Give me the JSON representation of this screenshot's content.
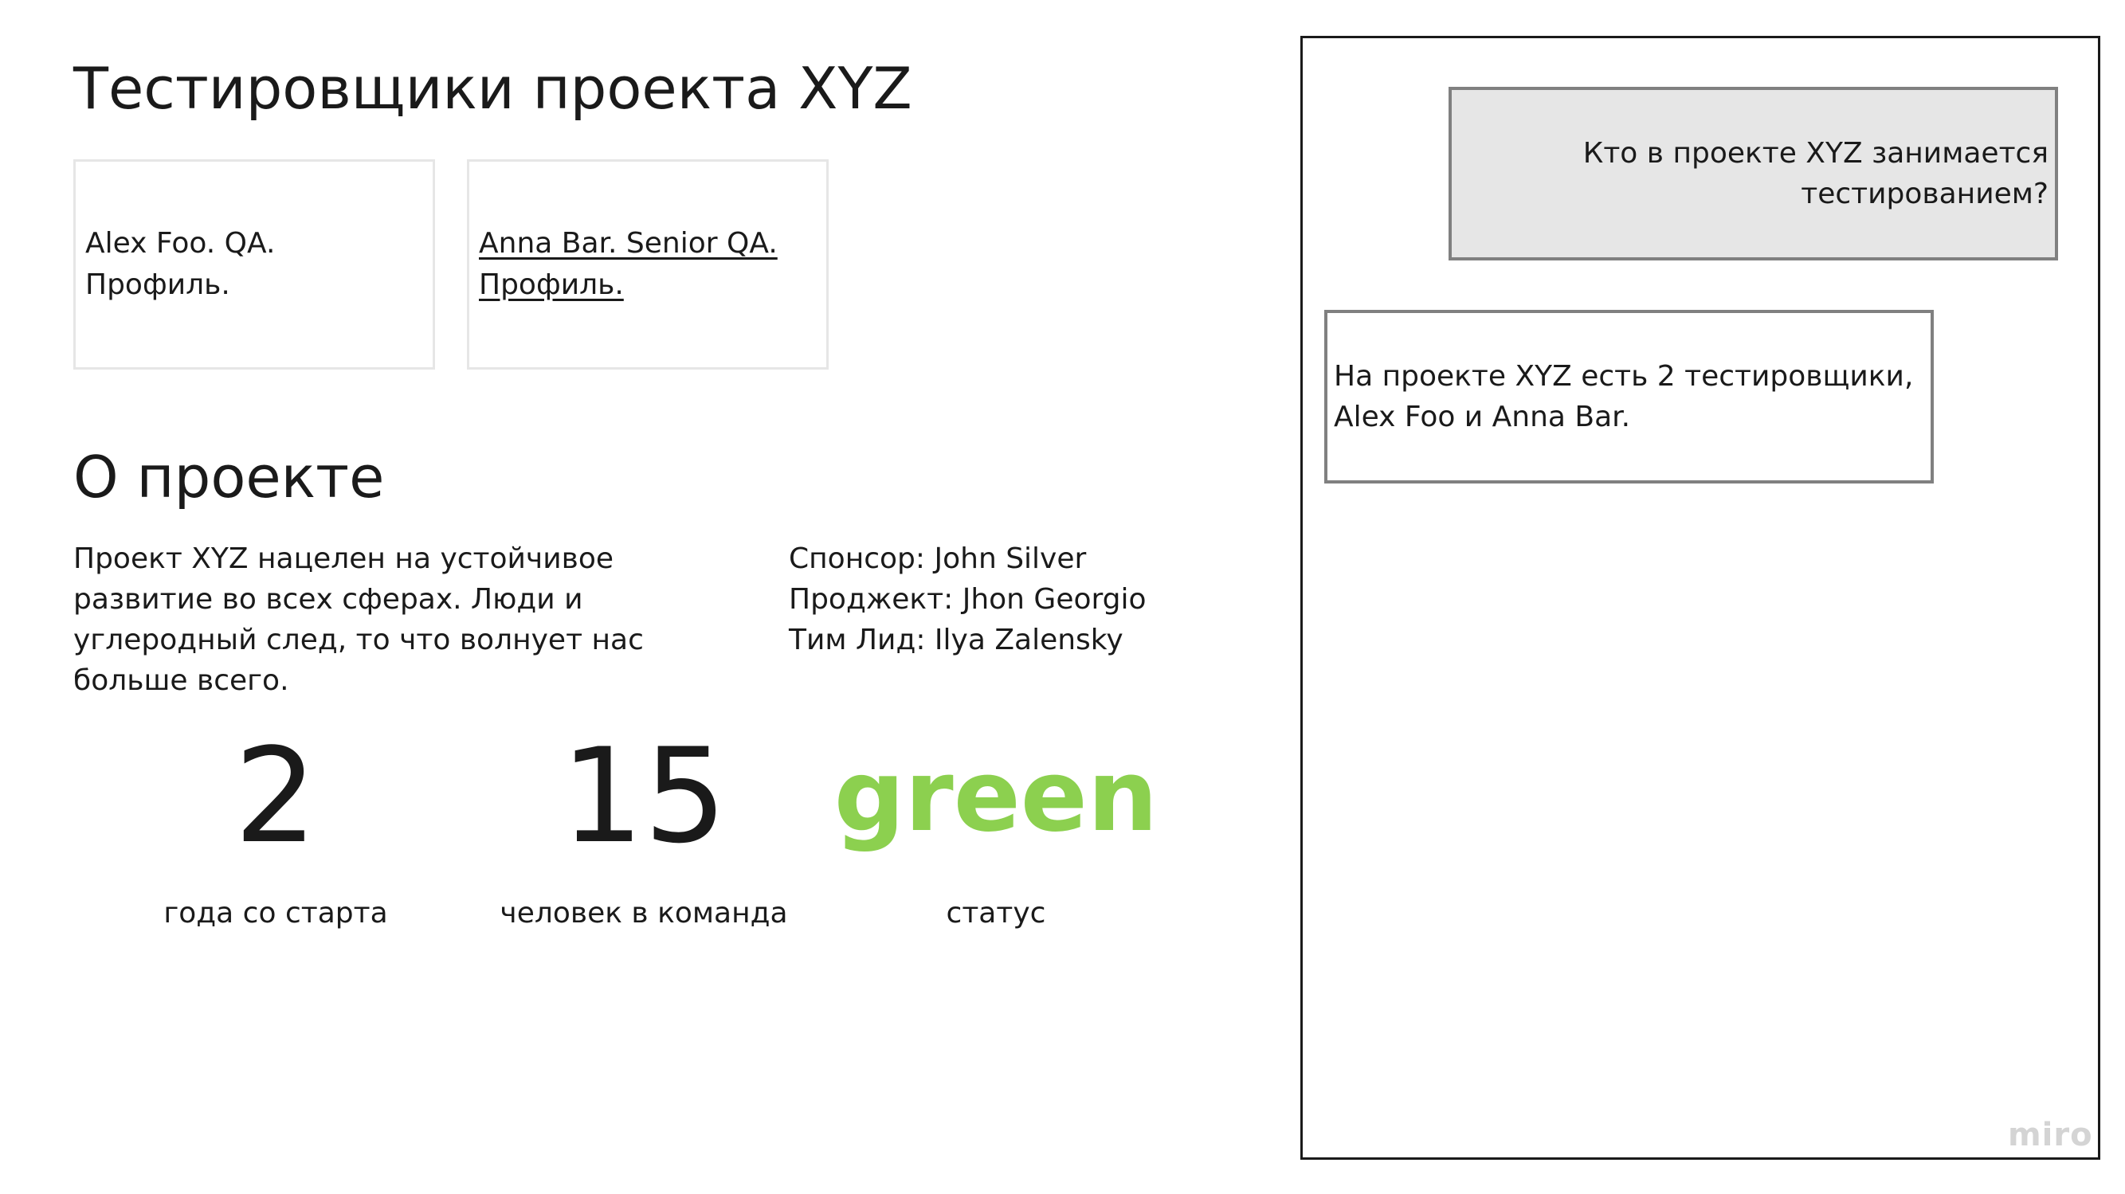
{
  "page_title": "Тестировщики проекта XYZ",
  "testers": [
    {
      "label": "Alex Foo. QA. Профиль."
    },
    {
      "label": "Anna Bar. Senior QA. Профиль."
    }
  ],
  "about": {
    "title": "О проекте",
    "description": "Проект XYZ нацелен на устойчивое развитие во всех сферах. Люди и углеродный след, то что волнует нас больше всего.",
    "roles": [
      "Спонсор: John Silver",
      "Проджект: Jhon Georgio",
      "Тим Лид: Ilya Zalensky"
    ]
  },
  "stats": [
    {
      "value": "2",
      "label": "года со старта"
    },
    {
      "value": "15",
      "label": "человек в команда"
    },
    {
      "value": "green",
      "label": "статус",
      "color": "#8cd04f"
    }
  ],
  "chat": {
    "question": "Кто в проекте XYZ занимается тестированием?",
    "answer": "На проекте XYZ есть 2 тестировщики, Alex Foo и Anna Bar."
  },
  "watermark": "miro",
  "colors": {
    "text": "#1a1a1a",
    "card_border": "#e6e6e6",
    "bubble_border": "#808080",
    "question_bg": "#e6e6e6",
    "status_green": "#8cd04f",
    "watermark": "#d4d4d4"
  }
}
